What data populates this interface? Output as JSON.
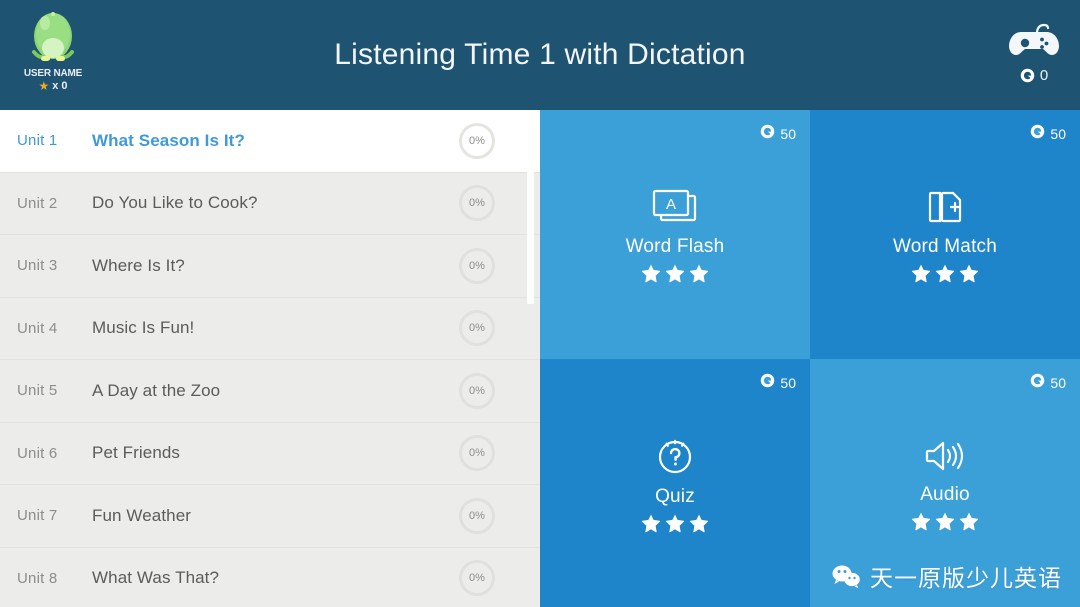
{
  "header": {
    "title": "Listening Time 1 with Dictation",
    "avatar": {
      "icon": "green-egg-character-avatar",
      "name": "USER NAME",
      "star_icon": "star-icon",
      "star_count": "x 0"
    },
    "game_controller": {
      "icon": "game-controller-icon",
      "coin_icon": "coin-icon",
      "coin_amount": "0"
    },
    "bg_color": "#1f5372"
  },
  "sidebar": {
    "bg_color": "#ececea",
    "active_color": "#3f9ad9",
    "scrollbar": {
      "icon": "vertical-scrollbar-thumb"
    },
    "units": [
      {
        "number": "Unit 1",
        "title": "What Season Is It?",
        "progress": "0%",
        "active": true
      },
      {
        "number": "Unit 2",
        "title": "Do You Like to Cook?",
        "progress": "0%",
        "active": false
      },
      {
        "number": "Unit 3",
        "title": "Where Is It?",
        "progress": "0%",
        "active": false
      },
      {
        "number": "Unit 4",
        "title": "Music Is Fun!",
        "progress": "0%",
        "active": false
      },
      {
        "number": "Unit 5",
        "title": "A Day at the Zoo",
        "progress": "0%",
        "active": false
      },
      {
        "number": "Unit 6",
        "title": "Pet Friends",
        "progress": "0%",
        "active": false
      },
      {
        "number": "Unit 7",
        "title": "Fun Weather",
        "progress": "0%",
        "active": false
      },
      {
        "number": "Unit 8",
        "title": "What Was That?",
        "progress": "0%",
        "active": false
      }
    ]
  },
  "activities": {
    "light_color": "#3ca0d8",
    "dark_color": "#1e85ca",
    "tiles": [
      {
        "label": "Word Flash",
        "icon": "word-flash-cards-icon",
        "cost": "50",
        "coin_icon": "coin-icon",
        "stars": 3,
        "shade": "light"
      },
      {
        "label": "Word Match",
        "icon": "word-match-document-plus-icon",
        "cost": "50",
        "coin_icon": "coin-icon",
        "stars": 3,
        "shade": "dark"
      },
      {
        "label": "Quiz",
        "icon": "quiz-question-mark-icon",
        "cost": "50",
        "coin_icon": "coin-icon",
        "stars": 3,
        "shade": "dark"
      },
      {
        "label": "Audio",
        "icon": "audio-speaker-icon",
        "cost": "50",
        "coin_icon": "coin-icon",
        "stars": 3,
        "shade": "light"
      }
    ]
  },
  "watermark": {
    "icon": "wechat-logo-icon",
    "text": "天一原版少儿英语"
  }
}
